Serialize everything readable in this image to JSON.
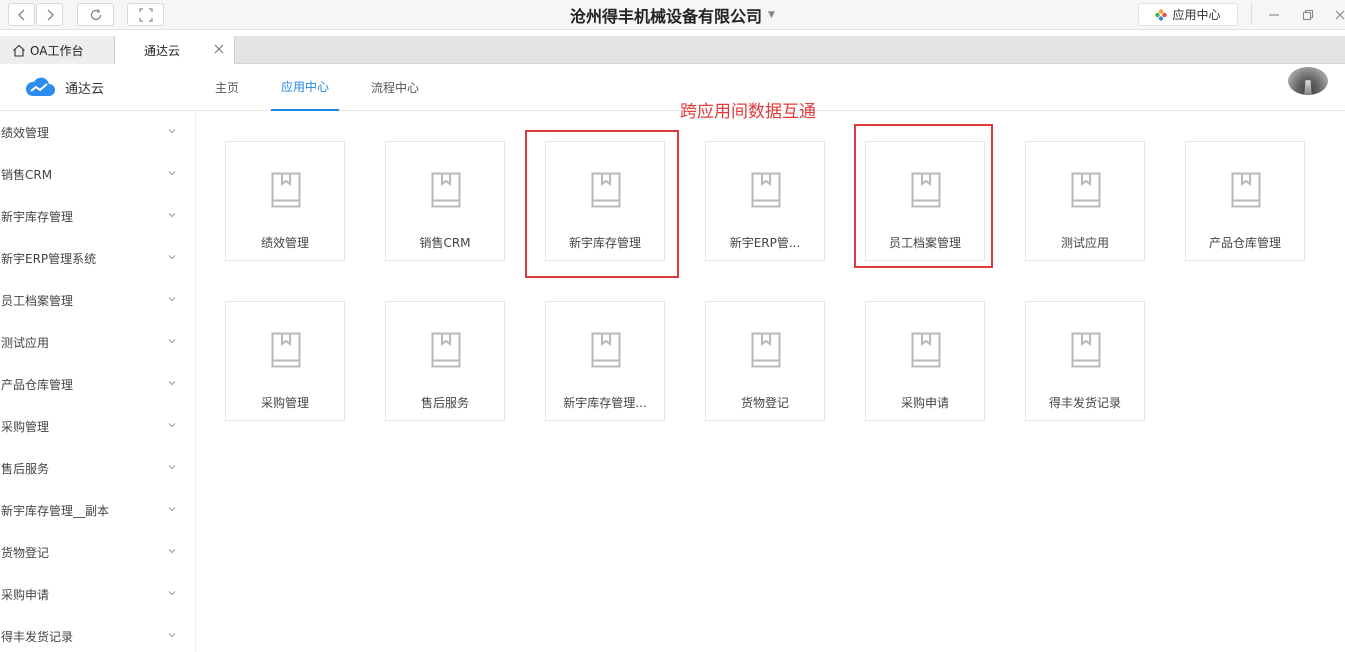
{
  "window": {
    "title": "沧州得丰机械设备有限公司",
    "app_center_label": "应用中心"
  },
  "tabs": [
    {
      "label": "OA工作台",
      "icon": "home-icon"
    },
    {
      "label": "通达云",
      "icon": "close-icon"
    }
  ],
  "header": {
    "brand": "通达云",
    "nav": [
      "主页",
      "应用中心",
      "流程中心"
    ],
    "active_nav": "应用中心"
  },
  "sidebar": {
    "items": [
      "绩效管理",
      "销售CRM",
      "新宇库存管理",
      "新宇ERP管理系统",
      "员工档案管理",
      "测试应用",
      "产品仓库管理",
      "采购管理",
      "售后服务",
      "新宇库存管理__副本",
      "货物登记",
      "采购申请",
      "得丰发货记录"
    ]
  },
  "annotation": "跨应用间数据互通",
  "apps": {
    "row1": [
      "绩效管理",
      "销售CRM",
      "新宇库存管理",
      "新宇ERP管...",
      "员工档案管理",
      "测试应用",
      "产品仓库管理"
    ],
    "row2": [
      "采购管理",
      "售后服务",
      "新宇库存管理...",
      "货物登记",
      "采购申请",
      "得丰发货记录"
    ]
  },
  "colors": {
    "accent": "#1e88e5",
    "highlight": "#e0393e",
    "icon": "#b8b8b8"
  }
}
